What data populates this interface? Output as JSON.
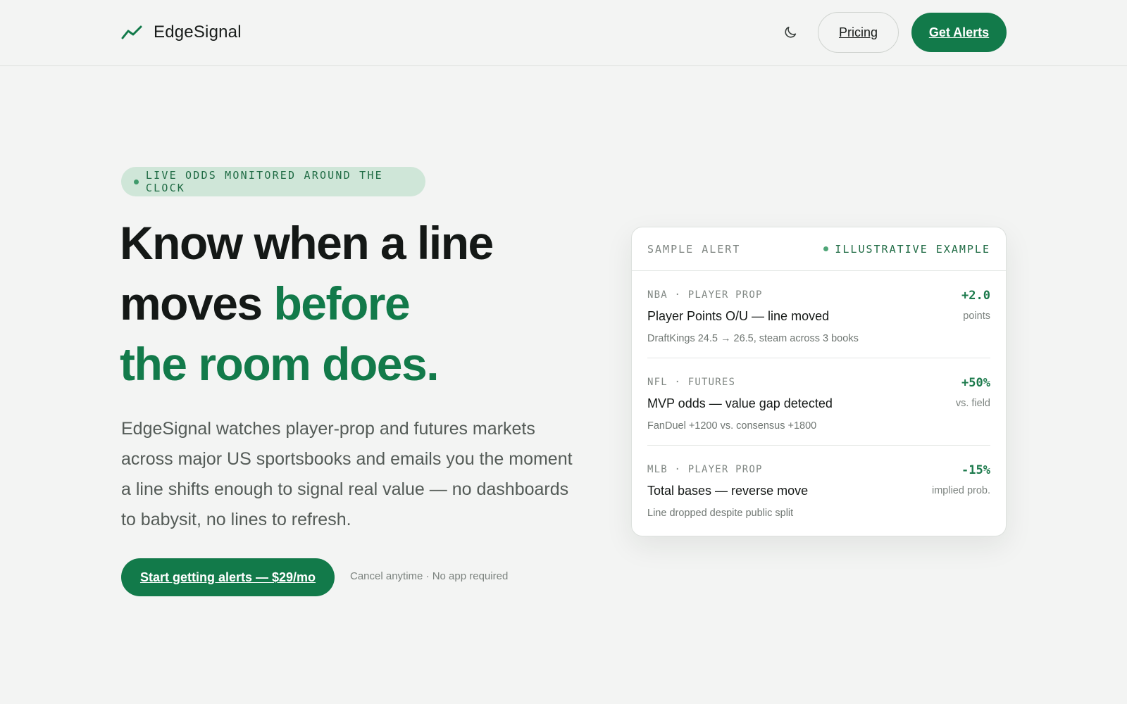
{
  "colors": {
    "brand_green": "#127a4a",
    "badge_bg": "#cfe6d8",
    "page_bg": "#f3f4f3",
    "text_dark": "#141816",
    "text_muted": "#545b57"
  },
  "nav": {
    "brand_icon": "trend-line-icon",
    "brand_name": "EdgeSignal",
    "theme_icon": "moon-icon",
    "pricing_label": "Pricing",
    "alerts_label": "Get Alerts"
  },
  "hero": {
    "badge": "LIVE ODDS MONITORED AROUND THE CLOCK",
    "headline_line1": "Know when a line",
    "headline_line2_plain": "moves ",
    "headline_line2_accent": "before",
    "headline_line3_accent": "the room does.",
    "subcopy": "EdgeSignal watches player-prop and futures markets across major US sportsbooks and emails you the moment a line shifts enough to signal real value — no dashboards to babysit, no lines to refresh.",
    "cta_label": "Start getting alerts — $29/mo",
    "cta_note": "Cancel anytime · No app required"
  },
  "sample_card": {
    "label": "SAMPLE ALERT",
    "tag": "ILLUSTRATIVE EXAMPLE",
    "alerts": [
      {
        "meta": "NBA · PLAYER PROP",
        "title": "Player Points O/U — line moved",
        "detail": "DraftKings 24.5 → 26.5, steam across 3 books",
        "delta": "+2.0",
        "unit": "points"
      },
      {
        "meta": "NFL · FUTURES",
        "title": "MVP odds — value gap detected",
        "detail": "FanDuel +1200 vs. consensus +1800",
        "delta": "+50%",
        "unit": "vs. field"
      },
      {
        "meta": "MLB · PLAYER PROP",
        "title": "Total bases — reverse move",
        "detail": "Line dropped despite public split",
        "delta": "-15%",
        "unit": "implied prob."
      }
    ]
  }
}
